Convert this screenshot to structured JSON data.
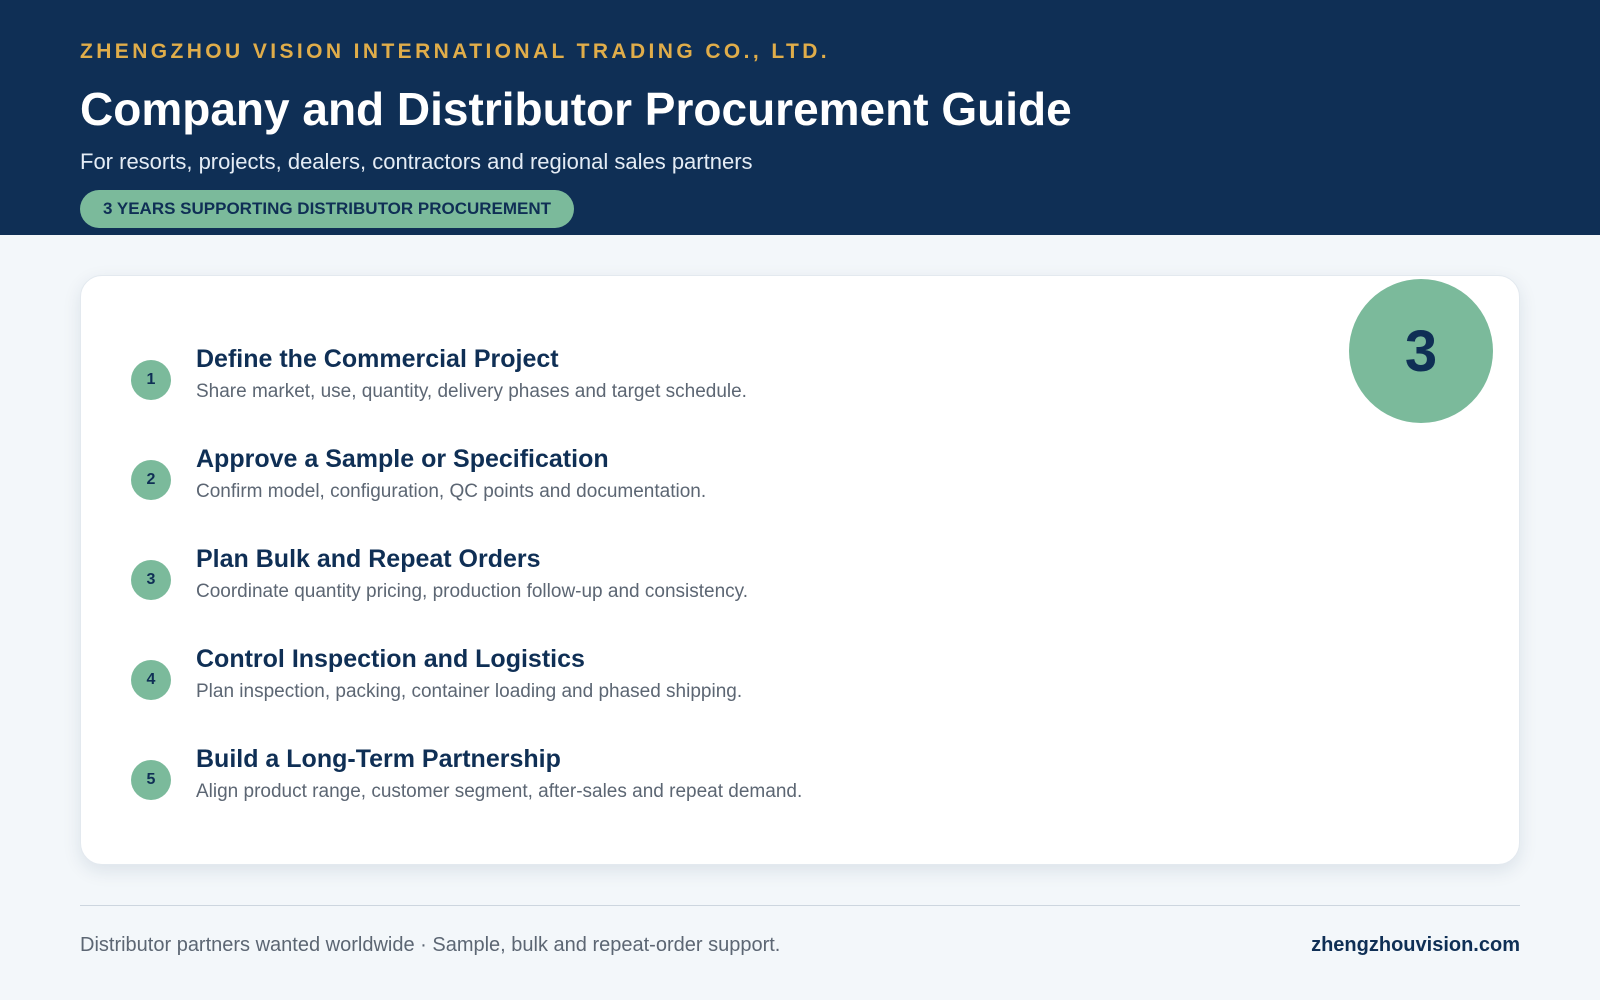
{
  "header": {
    "company": "ZHENGZHOU VISION INTERNATIONAL TRADING CO., LTD.",
    "title": "Company and Distributor Procurement Guide",
    "subtitle": "For resorts, projects, dealers, contractors and regional sales partners",
    "badge": "3 YEARS SUPPORTING DISTRIBUTOR PROCUREMENT"
  },
  "card": {
    "big_number": "3",
    "steps": [
      {
        "number": "1",
        "title": "Define the Commercial Project",
        "description": "Share market, use, quantity, delivery phases and target schedule."
      },
      {
        "number": "2",
        "title": "Approve a Sample or Specification",
        "description": "Confirm model, configuration, QC points and documentation."
      },
      {
        "number": "3",
        "title": "Plan Bulk and Repeat Orders",
        "description": "Coordinate quantity pricing, production follow-up and consistency."
      },
      {
        "number": "4",
        "title": "Control Inspection and Logistics",
        "description": "Plan inspection, packing, container loading and phased shipping."
      },
      {
        "number": "5",
        "title": "Build a Long-Term Partnership",
        "description": "Align product range, customer segment, after-sales and repeat demand."
      }
    ]
  },
  "footer": {
    "tagline": "Distributor partners wanted worldwide · Sample, bulk and repeat-order support.",
    "website": "zhengzhouvision.com"
  },
  "colors": {
    "navy": "#0f2f55",
    "gold": "#e0ad4a",
    "green": "#7bba9b",
    "background": "#f3f7fa"
  }
}
